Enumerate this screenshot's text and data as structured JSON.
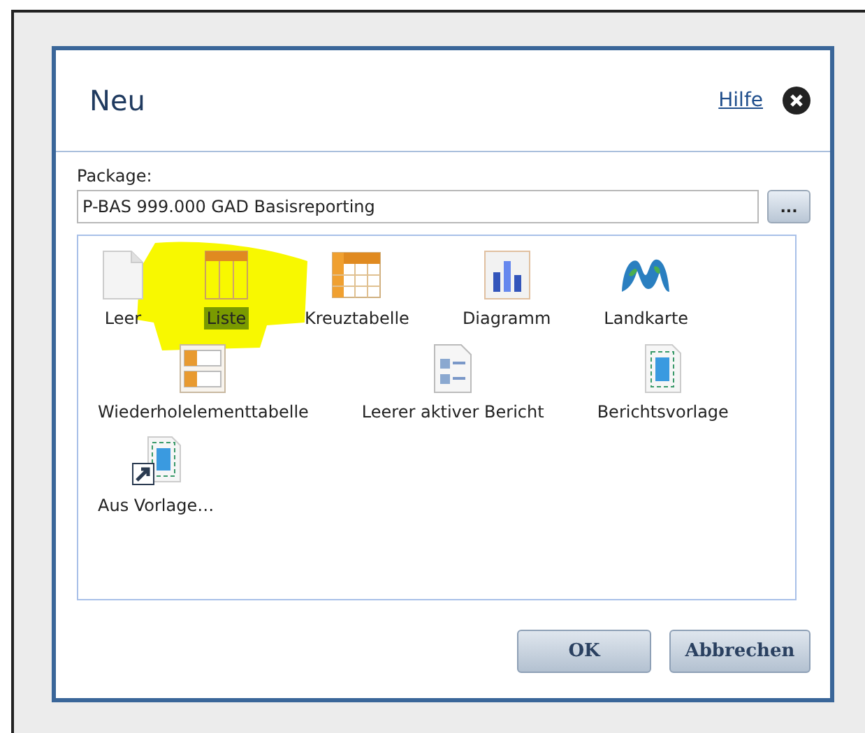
{
  "dialog": {
    "title": "Neu",
    "help_link": "Hilfe"
  },
  "package": {
    "label": "Package:",
    "value": "P-BAS 999.000 GAD Basisreporting",
    "browse_button": "..."
  },
  "items": [
    {
      "label": "Leer",
      "kind": "blank",
      "selected": false
    },
    {
      "label": "Liste",
      "kind": "list",
      "selected": true
    },
    {
      "label": "Kreuztabelle",
      "kind": "crosstab",
      "selected": false
    },
    {
      "label": "Diagramm",
      "kind": "chart",
      "selected": false
    },
    {
      "label": "Landkarte",
      "kind": "map",
      "selected": false
    },
    {
      "label": "Wiederholelementtabelle",
      "kind": "repeater",
      "selected": false
    },
    {
      "label": "Leerer aktiver Bericht",
      "kind": "active",
      "selected": false
    },
    {
      "label": "Berichtsvorlage",
      "kind": "template",
      "selected": false
    },
    {
      "label": "Aus Vorlage…",
      "kind": "from-template",
      "selected": false
    }
  ],
  "buttons": [
    {
      "label": "OK",
      "kind": "ok"
    },
    {
      "label": "Abbrechen",
      "kind": "cancel"
    }
  ]
}
